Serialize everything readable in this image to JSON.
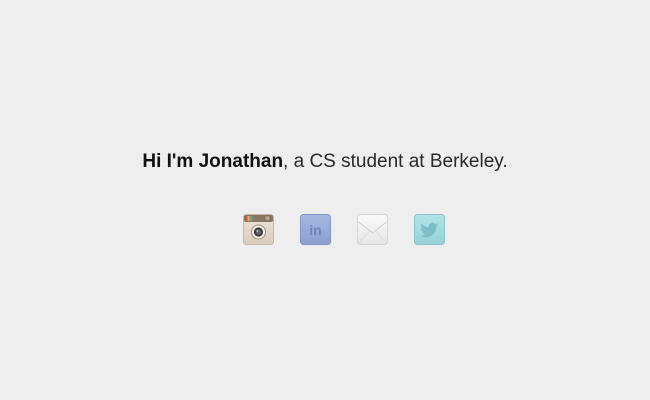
{
  "intro": {
    "name": "Hi I'm Jonathan",
    "rest": ", a CS student at Berkeley."
  },
  "social": [
    {
      "icon": "instagram-icon"
    },
    {
      "icon": "linkedin-icon",
      "glyph": "in"
    },
    {
      "icon": "mail-icon"
    },
    {
      "icon": "twitter-icon"
    }
  ],
  "colors": {
    "background": "#eeeeee",
    "text": "#2a2a2a",
    "linkedin": "#97acd9",
    "twitter": "#a6dde3",
    "instagram": "#e4d9cb",
    "mail": "#f7f7f7"
  }
}
